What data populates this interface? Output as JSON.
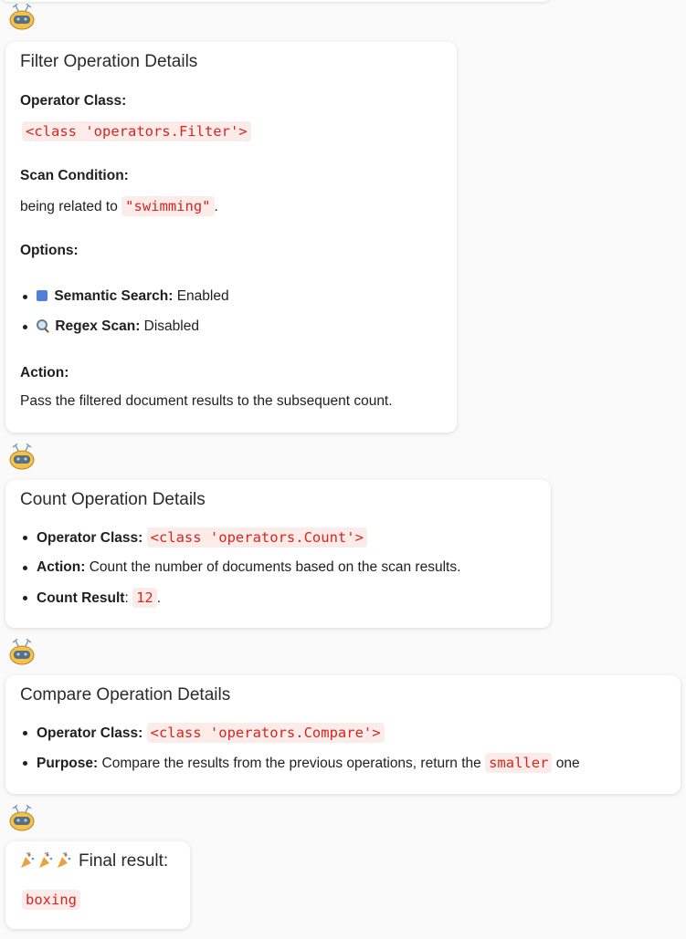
{
  "filter_card": {
    "title": "Filter Operation Details",
    "operator_heading": "Operator Class:",
    "operator_class": "<class 'operators.Filter'>",
    "scan_heading": "Scan Condition:",
    "scan_prefix": "being related to",
    "scan_value": "\"swimming\"",
    "scan_suffix": ".",
    "options_heading": "Options:",
    "options": [
      {
        "icon": "abcd-icon",
        "label": "Semantic Search:",
        "value": "Enabled"
      },
      {
        "icon": "magnifier-icon",
        "label": "Regex Scan:",
        "value": "Disabled"
      }
    ],
    "action_heading": "Action:",
    "action_text": "Pass the filtered document results to the subsequent count."
  },
  "count_card": {
    "title": "Count Operation Details",
    "operator_label": "Operator Class:",
    "operator_class": "<class 'operators.Count'>",
    "action_label": "Action:",
    "action_text": "Count the number of documents based on the scan results.",
    "result_label": "Count Result",
    "result_colon": ":",
    "result_value": "12",
    "result_suffix": "."
  },
  "compare_card": {
    "title": "Compare Operation Details",
    "operator_label": "Operator Class:",
    "operator_class": "<class 'operators.Compare'>",
    "purpose_label": "Purpose:",
    "purpose_text": "Compare the results from the previous operations, return the",
    "purpose_value": "smaller",
    "purpose_suffix": "one"
  },
  "final_card": {
    "icon": "party-popper-icon",
    "title": "Final result:",
    "result": "boxing"
  },
  "colors": {
    "code_text": "#d6261e",
    "code_bg": "#fbecea",
    "avatar_body": "#f3c24a"
  }
}
